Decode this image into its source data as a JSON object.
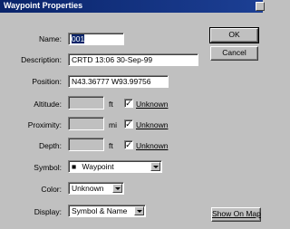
{
  "window": {
    "title": "Waypoint Properties"
  },
  "fields": {
    "name": {
      "label": "Name:",
      "value": "001"
    },
    "description": {
      "label": "Description:",
      "value": "CRTD 13:06 30-Sep-99"
    },
    "position": {
      "label": "Position:",
      "value": "N43.36777 W93.99756"
    },
    "altitude": {
      "label": "Altitude:",
      "value": "",
      "unit": "ft",
      "unknown_label": "Unknown",
      "unknown_checked": true
    },
    "proximity": {
      "label": "Proximity:",
      "value": "",
      "unit": "mi",
      "unknown_label": "Unknown",
      "unknown_checked": true
    },
    "depth": {
      "label": "Depth:",
      "value": "",
      "unit": "ft",
      "unknown_label": "Unknown",
      "unknown_checked": true
    },
    "symbol": {
      "label": "Symbol:",
      "value": "Waypoint",
      "glyph": "■"
    },
    "color": {
      "label": "Color:",
      "value": "Unknown"
    },
    "display": {
      "label": "Display:",
      "value": "Symbol & Name"
    }
  },
  "buttons": {
    "ok": "OK",
    "cancel": "Cancel",
    "show_on_map": "Show On Map"
  },
  "check_glyph": "✓",
  "colors": {
    "titlebar": "#0a246a",
    "face": "#c0c0c0",
    "selection": "#0a246a"
  }
}
